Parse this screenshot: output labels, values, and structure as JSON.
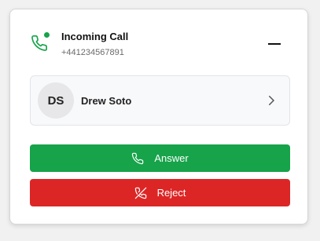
{
  "header": {
    "title": "Incoming Call",
    "caller_number": "+441234567891",
    "minimize_label": "Minimize"
  },
  "contact": {
    "initials": "DS",
    "name": "Drew Soto"
  },
  "actions": {
    "answer_label": "Answer",
    "reject_label": "Reject"
  },
  "colors": {
    "accept": "#16a34a",
    "reject": "#dc2626"
  },
  "icons": {
    "header": "phone-icon",
    "status": "online-dot",
    "minimize": "minus-icon",
    "contact": "chevron-right-icon",
    "answer": "phone-icon",
    "reject": "phone-off-icon"
  }
}
